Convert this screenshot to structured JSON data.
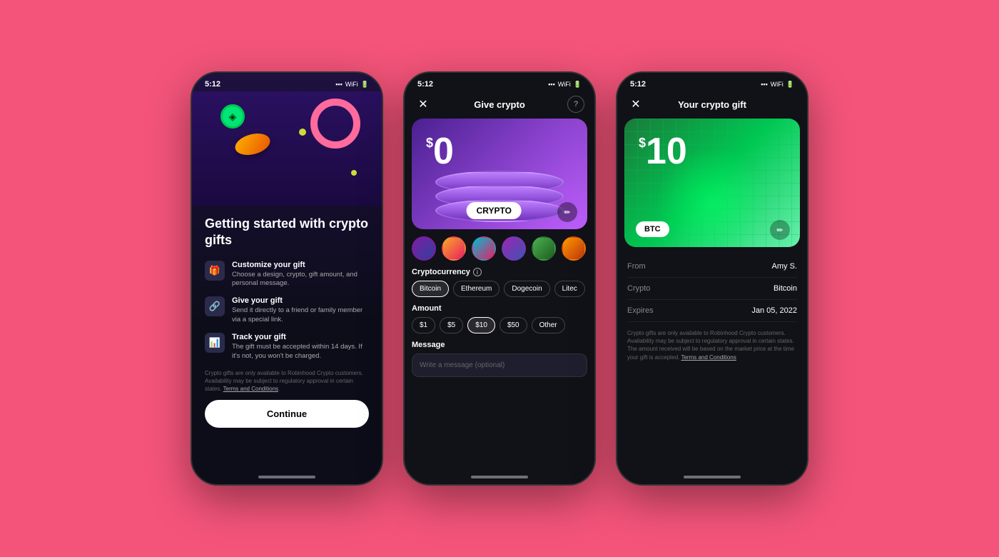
{
  "bg_color": "#f4547a",
  "phone1": {
    "status_time": "5:12",
    "title": "Getting started with crypto gifts",
    "features": [
      {
        "icon": "🎁",
        "title": "Customize your gift",
        "desc": "Choose a design, crypto, gift amount, and personal message."
      },
      {
        "icon": "🔗",
        "title": "Give your gift",
        "desc": "Send it directly to a friend or family member via a special link."
      },
      {
        "icon": "📊",
        "title": "Track your gift",
        "desc": "The gift must be accepted within 14 days. If it's not, you won't be charged."
      }
    ],
    "disclaimer": "Crypto gifts are only available to Robinhood Crypto customers. Availability may be subject to regulatory approval in certain states.",
    "disclaimer_link": "Terms and Conditions",
    "continue_label": "Continue"
  },
  "phone2": {
    "status_time": "5:12",
    "title": "Give crypto",
    "amount_dollar": "$",
    "amount_value": "0",
    "card_label": "CRYPTO",
    "cryptocurrency_label": "Cryptocurrency",
    "cryptocurrencies": [
      "Bitcoin",
      "Ethereum",
      "Dogecoin",
      "Litec"
    ],
    "amount_label": "Amount",
    "amounts": [
      "$1",
      "$5",
      "$10",
      "$50",
      "Other"
    ],
    "message_label": "Message",
    "message_placeholder": "Write a message (optional)"
  },
  "phone3": {
    "status_time": "5:12",
    "title": "Your crypto gift",
    "amount_dollar": "$",
    "amount_value": "10",
    "btc_label": "BTC",
    "from_label": "From",
    "from_value": "Amy S.",
    "crypto_label": "Crypto",
    "crypto_value": "Bitcoin",
    "expires_label": "Expires",
    "expires_value": "Jan 05, 2022",
    "disclaimer": "Crypto gifts are only available to Robinhood Crypto customers. Availability may be subject to regulatory approval in certain states. The amount received will be based on the market price at the time your gift is accepted.",
    "disclaimer_link": "Terms and Conditions"
  }
}
